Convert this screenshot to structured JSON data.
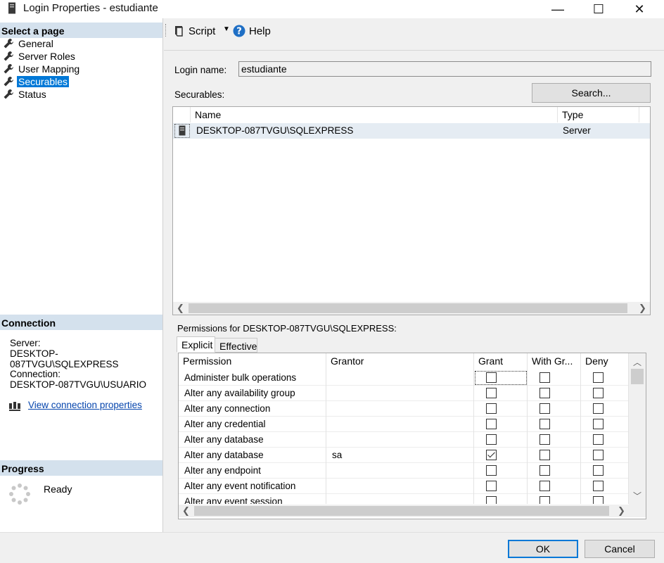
{
  "window": {
    "title": "Login Properties - estudiante",
    "minimize_glyph": "—",
    "maximize_glyph": "☐",
    "close_glyph": "✕"
  },
  "left": {
    "select_page_header": "Select a page",
    "pages": [
      {
        "label": "General",
        "icon": "wrench-icon"
      },
      {
        "label": "Server Roles",
        "icon": "wrench-icon"
      },
      {
        "label": "User Mapping",
        "icon": "wrench-icon"
      },
      {
        "label": "Securables",
        "icon": "wrench-icon",
        "selected": true
      },
      {
        "label": "Status",
        "icon": "wrench-icon"
      }
    ],
    "connection_header": "Connection",
    "server_label": "Server:",
    "server_value": "DESKTOP-087TVGU\\SQLEXPRESS",
    "connection_label": "Connection:",
    "connection_value": "DESKTOP-087TVGU\\USUARIO",
    "view_connection_link": "View connection properties",
    "progress_header": "Progress",
    "progress_status": "Ready"
  },
  "toolbar": {
    "script_label": "Script",
    "help_label": "Help"
  },
  "main": {
    "login_name_label": "Login name:",
    "login_name_value": "estudiante",
    "securables_label": "Securables:",
    "search_button": "Search...",
    "securables_columns": [
      "Name",
      "Type"
    ],
    "securables_rows": [
      {
        "name": "DESKTOP-087TVGU\\SQLEXPRESS",
        "type": "Server"
      }
    ],
    "permissions_for_label": "Permissions for DESKTOP-087TVGU\\SQLEXPRESS:",
    "tabs": [
      "Explicit",
      "Effective"
    ],
    "perm_columns": [
      "Permission",
      "Grantor",
      "Grant",
      "With Gr...",
      "Deny"
    ],
    "perm_rows": [
      {
        "permission": "Administer bulk operations",
        "grantor": "",
        "grant": false,
        "with_grant": false,
        "deny": false
      },
      {
        "permission": "Alter any availability group",
        "grantor": "",
        "grant": false,
        "with_grant": false,
        "deny": false
      },
      {
        "permission": "Alter any connection",
        "grantor": "",
        "grant": false,
        "with_grant": false,
        "deny": false
      },
      {
        "permission": "Alter any credential",
        "grantor": "",
        "grant": false,
        "with_grant": false,
        "deny": false
      },
      {
        "permission": "Alter any database",
        "grantor": "",
        "grant": false,
        "with_grant": false,
        "deny": false
      },
      {
        "permission": "Alter any database",
        "grantor": "sa",
        "grant": true,
        "with_grant": false,
        "deny": false
      },
      {
        "permission": "Alter any endpoint",
        "grantor": "",
        "grant": false,
        "with_grant": false,
        "deny": false
      },
      {
        "permission": "Alter any event notification",
        "grantor": "",
        "grant": false,
        "with_grant": false,
        "deny": false
      },
      {
        "permission": "Alter any event session",
        "grantor": "",
        "grant": false,
        "with_grant": false,
        "deny": false
      }
    ],
    "ok_button": "OK",
    "cancel_button": "Cancel"
  },
  "colors": {
    "selection": "#0078d7",
    "section_header": "#d4e1ed",
    "link": "#0645ad"
  }
}
